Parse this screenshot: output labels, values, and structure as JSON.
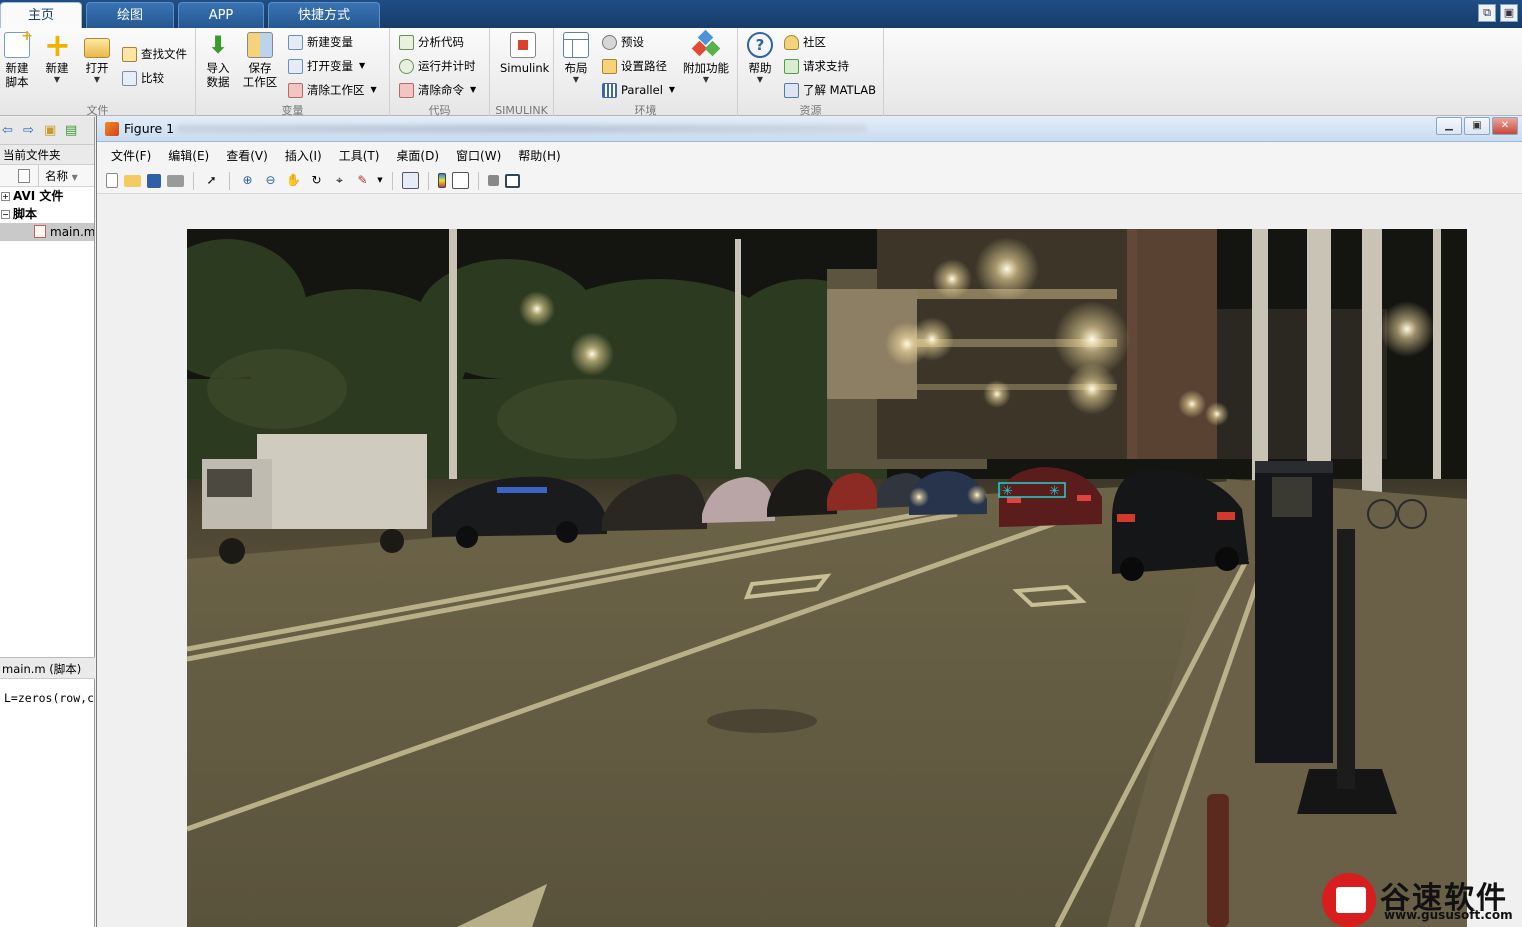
{
  "tabs": [
    "主页",
    "绘图",
    "APP",
    "快捷方式"
  ],
  "ribbon": {
    "file": {
      "label": "文件",
      "new_script": [
        "新建",
        "脚本"
      ],
      "new": "新建",
      "open": "打开",
      "find_files": "查找文件",
      "compare": "比较"
    },
    "variable": {
      "label": "变量",
      "import_data": [
        "导入",
        "数据"
      ],
      "save_workspace": [
        "保存",
        "工作区"
      ],
      "new_variable": "新建变量",
      "open_variable": "打开变量",
      "clear_workspace": "清除工作区"
    },
    "code": {
      "label": "代码",
      "analyze_code": "分析代码",
      "run_and_time": "运行并计时",
      "clear_commands": "清除命令"
    },
    "simulink": {
      "label": "SIMULINK",
      "simulink": "Simulink"
    },
    "environment": {
      "label": "环境",
      "layout": "布局",
      "preferences": "预设",
      "set_path": "设置路径",
      "parallel": "Parallel",
      "addons": "附加功能"
    },
    "resources": {
      "label": "资源",
      "help": "帮助",
      "community": "社区",
      "request_support": "请求支持",
      "learn_matlab": "了解 MATLAB"
    }
  },
  "left_panel": {
    "current_folder_label": "当前文件夹",
    "name_column": "名称",
    "tree": [
      {
        "label": "AVI 文件",
        "expander": "+"
      },
      {
        "label": "脚本",
        "expander": "−"
      },
      {
        "label": "main.m"
      }
    ],
    "details_header": "main.m  (脚本)",
    "details_code": "L=zeros(row,col);"
  },
  "figure": {
    "title": "Figure 1",
    "menu": [
      "文件(F)",
      "编辑(E)",
      "查看(V)",
      "插入(I)",
      "工具(T)",
      "桌面(D)",
      "窗口(W)",
      "帮助(H)"
    ]
  },
  "watermark": {
    "name": "谷速软件",
    "url": "www.gususoft.com"
  },
  "colors": {
    "tabbar": "#1f4e86",
    "accent": "#2a6fb4",
    "watermark_red": "#d71d1d",
    "marker": "#1fd3d3"
  }
}
